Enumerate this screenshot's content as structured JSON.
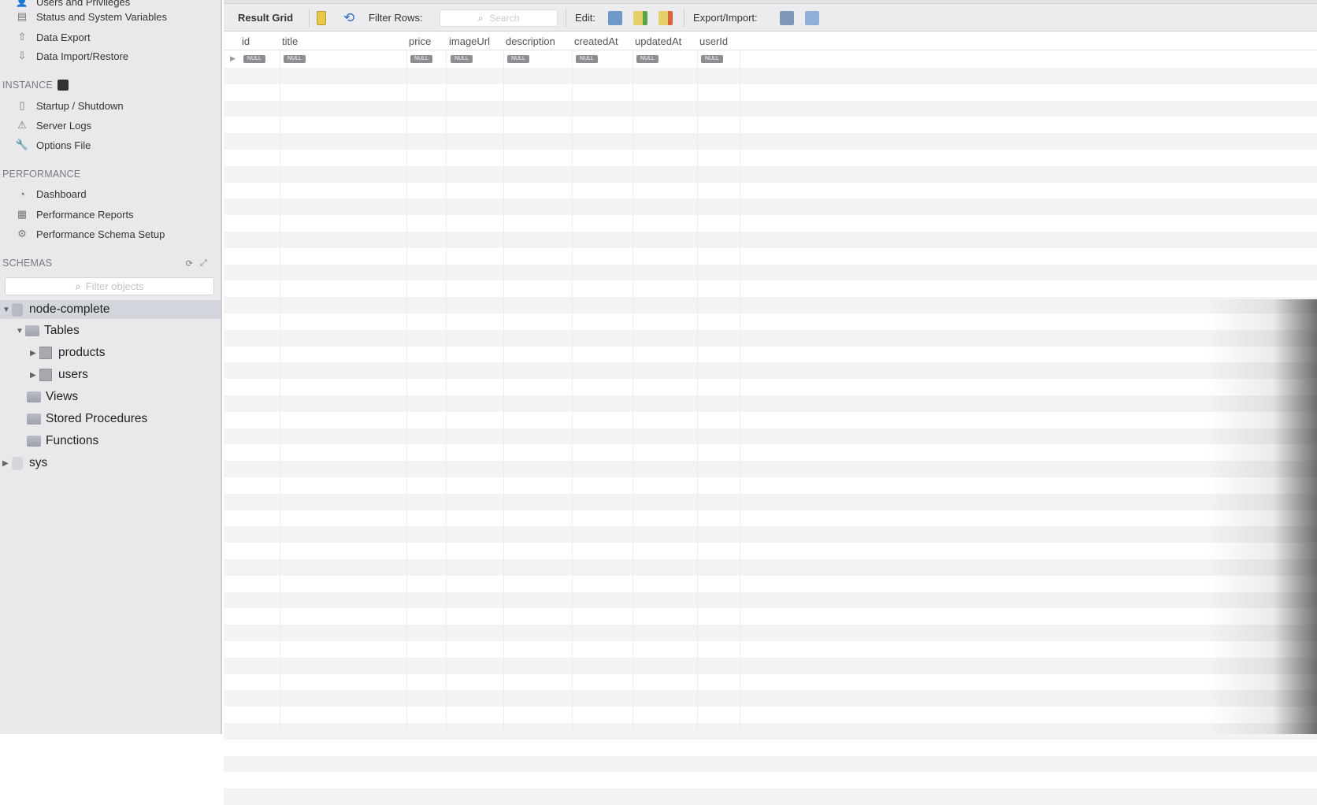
{
  "sidebar": {
    "management": [
      {
        "label": "Users and Privileges",
        "icon": "user-icon"
      },
      {
        "label": "Status and System Variables",
        "icon": "monitor-icon"
      },
      {
        "label": "Data Export",
        "icon": "export-icon"
      },
      {
        "label": "Data Import/Restore",
        "icon": "import-icon"
      }
    ],
    "instance_header": "INSTANCE",
    "instance": [
      {
        "label": "Startup / Shutdown",
        "icon": "power-icon"
      },
      {
        "label": "Server Logs",
        "icon": "warning-icon"
      },
      {
        "label": "Options File",
        "icon": "wrench-icon"
      }
    ],
    "performance_header": "PERFORMANCE",
    "performance": [
      {
        "label": "Dashboard",
        "icon": "gauge-icon"
      },
      {
        "label": "Performance Reports",
        "icon": "reports-icon"
      },
      {
        "label": "Performance Schema Setup",
        "icon": "setup-icon"
      }
    ],
    "schemas_header": "SCHEMAS",
    "filter_placeholder": "Filter objects",
    "tree": {
      "schema": "node-complete",
      "tables": "Tables",
      "table_items": [
        "products",
        "users"
      ],
      "views": "Views",
      "procedures": "Stored Procedures",
      "functions": "Functions",
      "other_schema": "sys"
    }
  },
  "toolbar": {
    "result_grid": "Result Grid",
    "filter_rows": "Filter Rows:",
    "search_placeholder": "Search",
    "edit": "Edit:",
    "export_import": "Export/Import:"
  },
  "grid": {
    "columns": [
      "id",
      "title",
      "price",
      "imageUrl",
      "description",
      "createdAt",
      "updatedAt",
      "userId"
    ],
    "row": [
      "NULL",
      "NULL",
      "NULL",
      "NULL",
      "NULL",
      "NULL",
      "NULL",
      "NULL"
    ]
  }
}
